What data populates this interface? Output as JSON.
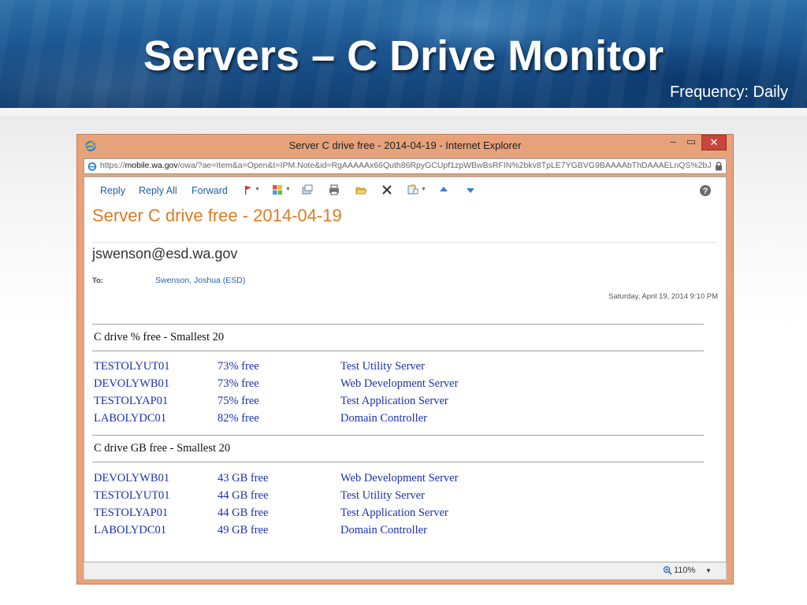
{
  "slide": {
    "title": "Servers – C Drive Monitor",
    "subtitle": "Frequency: Daily"
  },
  "window": {
    "title": "Server C drive free - 2014-04-19 - Internet Explorer",
    "minimize": "–",
    "maximize": "▭",
    "close": "✕",
    "address_scheme": "https://",
    "address_host": "mobile.wa.gov",
    "address_rest": "/owa/?ae=Item&a=Open&t=IPM.Note&id=RgAAAAAx66Quth86RpyGCUpf1zpWBwBsRFIN%2bkv8TpLE7YGBVG9BAAAAbThDAAAELnQS%2bJ"
  },
  "toolbar": {
    "reply": "Reply",
    "reply_all": "Reply All",
    "forward": "Forward"
  },
  "email": {
    "subject": "Server C drive free - 2014-04-19",
    "sender": "jswenson@esd.wa.gov",
    "to_label": "To:",
    "to_value": "Swenson, Joshua (ESD)",
    "sent": "Saturday, April 19, 2014 9:10 PM"
  },
  "report": {
    "percent_section": {
      "title": "C drive % free - Smallest 20",
      "rows": [
        {
          "name": "TESTOLYUT01",
          "value": "73% free",
          "desc": "Test Utility Server"
        },
        {
          "name": "DEVOLYWB01",
          "value": "73% free",
          "desc": "Web Development Server"
        },
        {
          "name": "TESTOLYAP01",
          "value": "75% free",
          "desc": "Test Application Server"
        },
        {
          "name": "LABOLYDC01",
          "value": "82% free",
          "desc": "Domain Controller"
        }
      ]
    },
    "gb_section": {
      "title": "C drive GB free - Smallest 20",
      "rows": [
        {
          "name": "DEVOLYWB01",
          "value": "43 GB free",
          "desc": "Web Development Server"
        },
        {
          "name": "TESTOLYUT01",
          "value": "44 GB free",
          "desc": "Test Utility Server"
        },
        {
          "name": "TESTOLYAP01",
          "value": "44 GB free",
          "desc": "Test Application Server"
        },
        {
          "name": "LABOLYDC01",
          "value": "49 GB free",
          "desc": "Domain Controller"
        }
      ]
    }
  },
  "statusbar": {
    "zoom": "110%"
  },
  "colors": {
    "subject": "#e07a25",
    "link": "#1a2fb0",
    "window_frame": "#e6a27a",
    "close_button": "#c9463d"
  }
}
